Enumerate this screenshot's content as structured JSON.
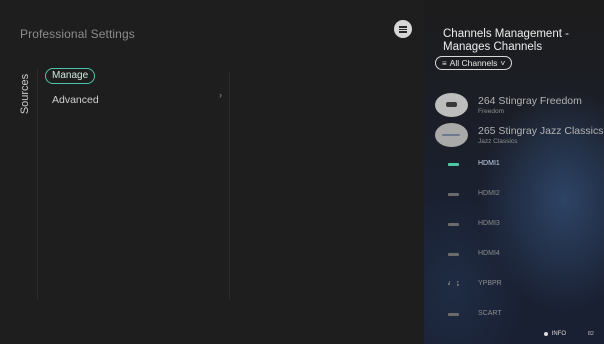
{
  "settings": {
    "title": "Professional Settings",
    "rail_label": "Sources",
    "manage_label": "Manage",
    "advanced_label": "Advanced",
    "chevron": "›"
  },
  "channels_panel": {
    "title_line1": "Channels Management -",
    "title_line2": "Manages Channels",
    "filter": {
      "icon": "≡",
      "label": "All Channels",
      "caret": "˅"
    },
    "channels": [
      {
        "number_name": "264 Stingray Freedom",
        "subtitle": "Freedom",
        "logo_icon": "channel-logo-icon"
      },
      {
        "number_name": "265 Stingray Jazz Classics",
        "subtitle": "Jazz Classics",
        "logo_icon": "channel-logo-icon"
      }
    ],
    "sources": [
      {
        "label": "HDMI1",
        "icon": "hdmi-icon",
        "active": true
      },
      {
        "label": "HDMI2",
        "icon": "hdmi-icon",
        "active": false
      },
      {
        "label": "HDMI3",
        "icon": "hdmi-icon",
        "active": false
      },
      {
        "label": "HDMI4",
        "icon": "hdmi-icon",
        "active": false
      },
      {
        "label": "YPBPR",
        "icon": "component-icon",
        "active": false
      },
      {
        "label": "SCART",
        "icon": "scart-icon",
        "active": false
      }
    ],
    "footer": {
      "info_label": "INFO",
      "corner_label": "82"
    }
  },
  "colors": {
    "accent": "#4fc6a8",
    "background": "#1e1e1e",
    "panel_gradient_dark": "#1c1c1c",
    "panel_gradient_blue": "#2d4466"
  }
}
